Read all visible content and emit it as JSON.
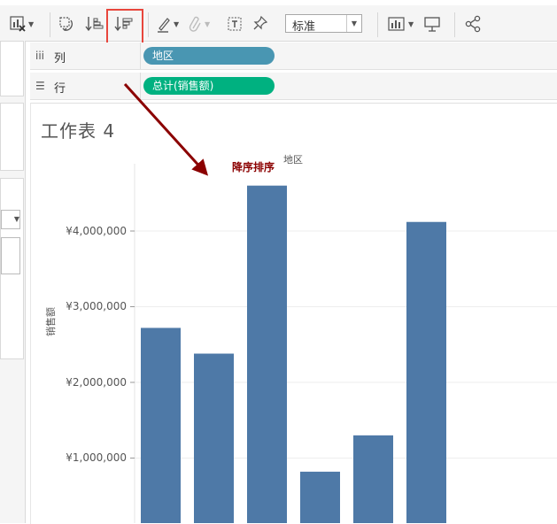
{
  "toolbar": {
    "show_me_icon": "chart-with-x-icon",
    "swap_icon": "swap-rows-columns-icon",
    "sort_asc_icon": "sort-ascending-icon",
    "sort_desc_icon": "sort-descending-icon",
    "highlight_icon": "pencil-highlight-icon",
    "paperclip_icon": "paperclip-icon",
    "textbox_icon": "text-box-icon",
    "pin_icon": "pin-icon",
    "fit_select": {
      "value": "标准"
    },
    "showme_icon": "bar-chart-icon",
    "presentation_icon": "presentation-icon",
    "share_icon": "share-icon"
  },
  "shelves": {
    "columns": {
      "label": "列",
      "pill": "地区",
      "pill_color": "#4996b2"
    },
    "rows": {
      "label": "行",
      "pill": "总计(销售额)",
      "pill_color": "#00b180"
    }
  },
  "sheet": {
    "title": "工作表 4",
    "header_x": "地区",
    "annotation": "降序排序",
    "ylabel": "销售额"
  },
  "chart_data": {
    "type": "bar",
    "categories": [
      "",
      "",
      "",
      "",
      "",
      ""
    ],
    "values": [
      2720000,
      2380000,
      4600000,
      820000,
      1300000,
      4120000
    ],
    "ylim": [
      0,
      5000000
    ],
    "yticks": [
      1000000,
      2000000,
      3000000,
      4000000
    ],
    "ytick_labels": [
      "¥1,000,000",
      "¥2,000,000",
      "¥3,000,000",
      "¥4,000,000"
    ],
    "ylabel": "销售额",
    "bar_color": "#4e79a7",
    "grid": true
  },
  "colors": {
    "highlight_box": "#e8463c",
    "arrow": "#8b0000"
  }
}
